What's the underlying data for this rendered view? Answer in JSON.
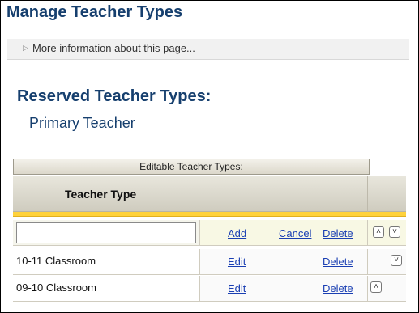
{
  "page": {
    "title": "Manage Teacher Types",
    "info_link": "More information about this page..."
  },
  "reserved": {
    "heading": "Reserved Teacher Types:",
    "items": [
      "Primary Teacher"
    ]
  },
  "grid": {
    "caption": "Editable Teacher Types:",
    "column_header": "Teacher Type",
    "new_row": {
      "value": "",
      "add_label": "Add",
      "cancel_label": "Cancel",
      "delete_label": "Delete",
      "move_up_icon": "double-chevron-up-icon",
      "move_down_icon": "double-chevron-down-icon"
    },
    "rows": [
      {
        "name": "10-11 Classroom",
        "edit_label": "Edit",
        "delete_label": "Delete",
        "move_icon": "double-chevron-down-icon"
      },
      {
        "name": "09-10 Classroom",
        "edit_label": "Edit",
        "delete_label": "Delete",
        "move_icon": "double-chevron-up-icon"
      }
    ]
  },
  "colors": {
    "heading": "#163f6e",
    "link": "#1a3fb3",
    "accent_bar": "#ffd23c"
  }
}
